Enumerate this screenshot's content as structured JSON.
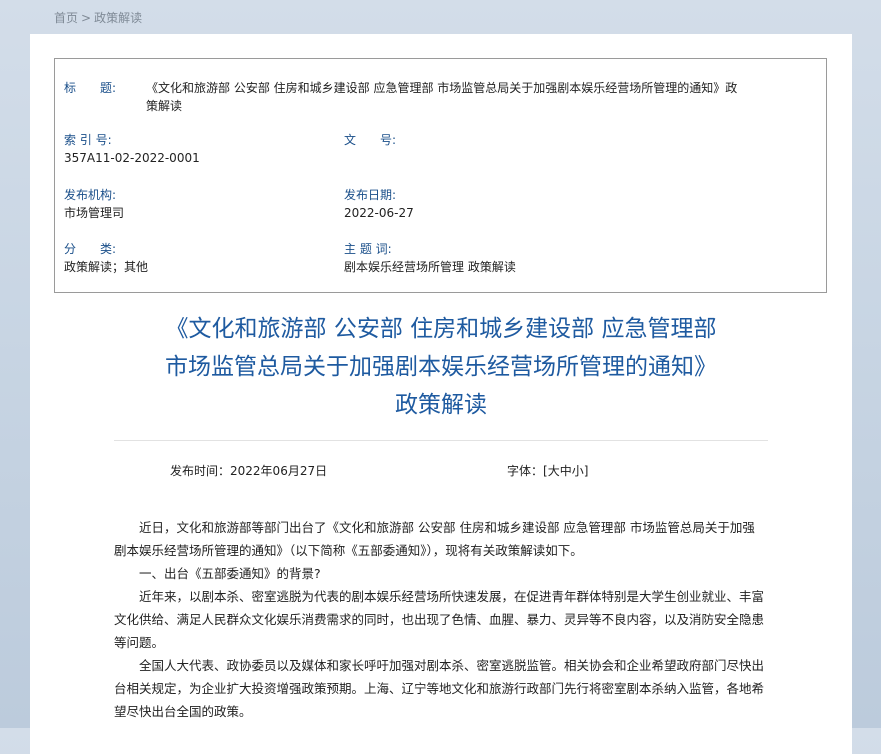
{
  "breadcrumb": {
    "home": "首页",
    "separator": ">",
    "current": "政策解读"
  },
  "meta": {
    "title_label": "标　　题:",
    "title_value": "《文化和旅游部 公安部 住房和城乡建设部 应急管理部 市场监管总局关于加强剧本娱乐经营场所管理的通知》政策解读",
    "index_label": "索 引 号:",
    "index_value": "357A11-02-2022-0001",
    "docno_label": "文　　号:",
    "docno_value": "",
    "agency_label": "发布机构:",
    "agency_value": "市场管理司",
    "date_label": "发布日期:",
    "date_value": "2022-06-27",
    "category_label": "分　　类:",
    "category_value": "政策解读；其他",
    "keywords_label": "主 题 词:",
    "keywords_value": "剧本娱乐经营场所管理 政策解读"
  },
  "doc_title": {
    "line1": "《文化和旅游部 公安部 住房和城乡建设部 应急管理部",
    "line2": "市场监管总局关于加强剧本娱乐经营场所管理的通知》",
    "line3": "政策解读"
  },
  "publish": {
    "time_label": "发布时间：",
    "time_value": "2022年06月27日",
    "font_label": "字体：",
    "font_open": "[",
    "font_large": "大",
    "font_medium": "中",
    "font_small": "小",
    "font_close": "]"
  },
  "body": [
    "近日，文化和旅游部等部门出台了《文化和旅游部 公安部 住房和城乡建设部 应急管理部 市场监管总局关于加强剧本娱乐经营场所管理的通知》（以下简称《五部委通知》），现将有关政策解读如下。",
    "一、出台《五部委通知》的背景?",
    "近年来，以剧本杀、密室逃脱为代表的剧本娱乐经营场所快速发展，在促进青年群体特别是大学生创业就业、丰富文化供给、满足人民群众文化娱乐消费需求的同时，也出现了色情、血腥、暴力、灵异等不良内容，以及消防安全隐患等问题。",
    "全国人大代表、政协委员以及媒体和家长呼吁加强对剧本杀、密室逃脱监管。相关协会和企业希望政府部门尽快出台相关规定，为企业扩大投资增强政策预期。上海、辽宁等地文化和旅游行政部门先行将密室剧本杀纳入监管，各地希望尽快出台全国的政策。"
  ]
}
